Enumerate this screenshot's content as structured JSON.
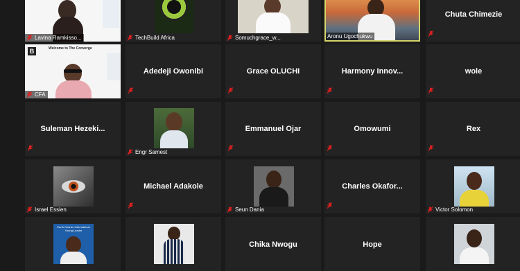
{
  "row1": {
    "t1": "Lavina Ramkisso...",
    "t2": "TechBuild Africa",
    "t3": "Somuchgrace_w...",
    "t4": "Aronu Ugochukwu",
    "t5": "Chuta Chimezie"
  },
  "row2": {
    "slide_title": "Welcome to The Converge",
    "t1": "CFA",
    "t2": "Adedeji Owonibi",
    "t3": "Grace OLUCHI",
    "t4": "Harmony Innov...",
    "t5": "wole"
  },
  "row3": {
    "t1": "Suleman Hezeki...",
    "t2": "Engr Samest",
    "t3": "Emmanuel Ojar",
    "t4": "Omowumi",
    "t5": "Rex"
  },
  "row4": {
    "t1": "Israel Essien",
    "t2": "Michael Adakole",
    "t3": "Seun Dania",
    "t4": "Charles Okafor...",
    "t5": "Victor Solomon"
  },
  "row5": {
    "poster_text": "Earth Charter International Young Leader",
    "t3": "Chika Nwogu",
    "t4": "Hope"
  },
  "icons": {
    "mute": "muted-microphone-icon"
  },
  "colors": {
    "active_speaker": "#d6d66a",
    "mute": "#e02020",
    "tile": "#232323"
  }
}
